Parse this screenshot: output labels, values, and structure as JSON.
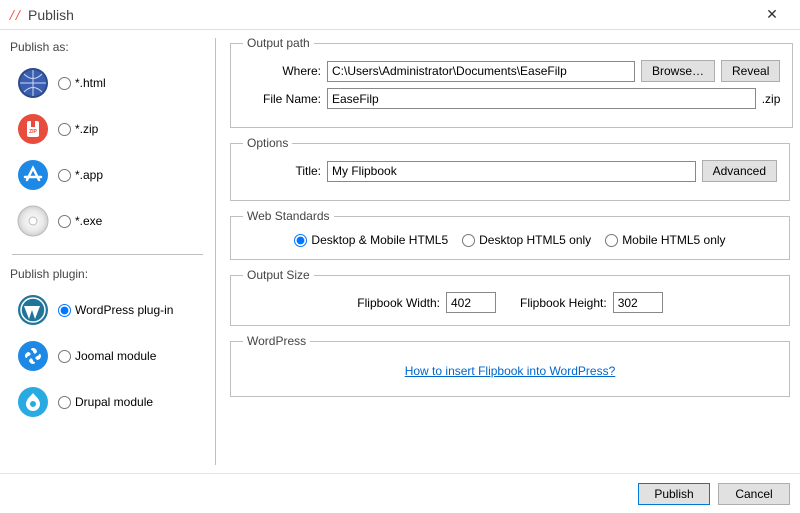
{
  "window": {
    "title": "Publish"
  },
  "left": {
    "publish_as_label": "Publish as:",
    "formats": [
      {
        "label": "*.html",
        "selected": false
      },
      {
        "label": "*.zip",
        "selected": false
      },
      {
        "label": "*.app",
        "selected": false
      },
      {
        "label": "*.exe",
        "selected": false
      }
    ],
    "plugin_label": "Publish plugin:",
    "plugins": [
      {
        "label": "WordPress plug-in",
        "selected": true
      },
      {
        "label": "Joomal module",
        "selected": false
      },
      {
        "label": "Drupal module",
        "selected": false
      }
    ]
  },
  "output_path": {
    "legend": "Output path",
    "where_label": "Where:",
    "where_value": "C:\\Users\\Administrator\\Documents\\EaseFilp",
    "browse_label": "Browse…",
    "reveal_label": "Reveal",
    "filename_label": "File Name:",
    "filename_value": "EaseFilp",
    "extension": ".zip"
  },
  "options": {
    "legend": "Options",
    "title_label": "Title:",
    "title_value": "My Flipbook",
    "advanced_label": "Advanced"
  },
  "web_standards": {
    "legend": "Web Standards",
    "choices": [
      "Desktop & Mobile HTML5",
      "Desktop HTML5 only",
      "Mobile HTML5 only"
    ],
    "selected_index": 0
  },
  "output_size": {
    "legend": "Output Size",
    "width_label": "Flipbook Width:",
    "width_value": "402",
    "height_label": "Flipbook Height:",
    "height_value": "302"
  },
  "wordpress": {
    "legend": "WordPress",
    "link_text": "How to insert Flipbook into WordPress?"
  },
  "footer": {
    "publish": "Publish",
    "cancel": "Cancel"
  }
}
